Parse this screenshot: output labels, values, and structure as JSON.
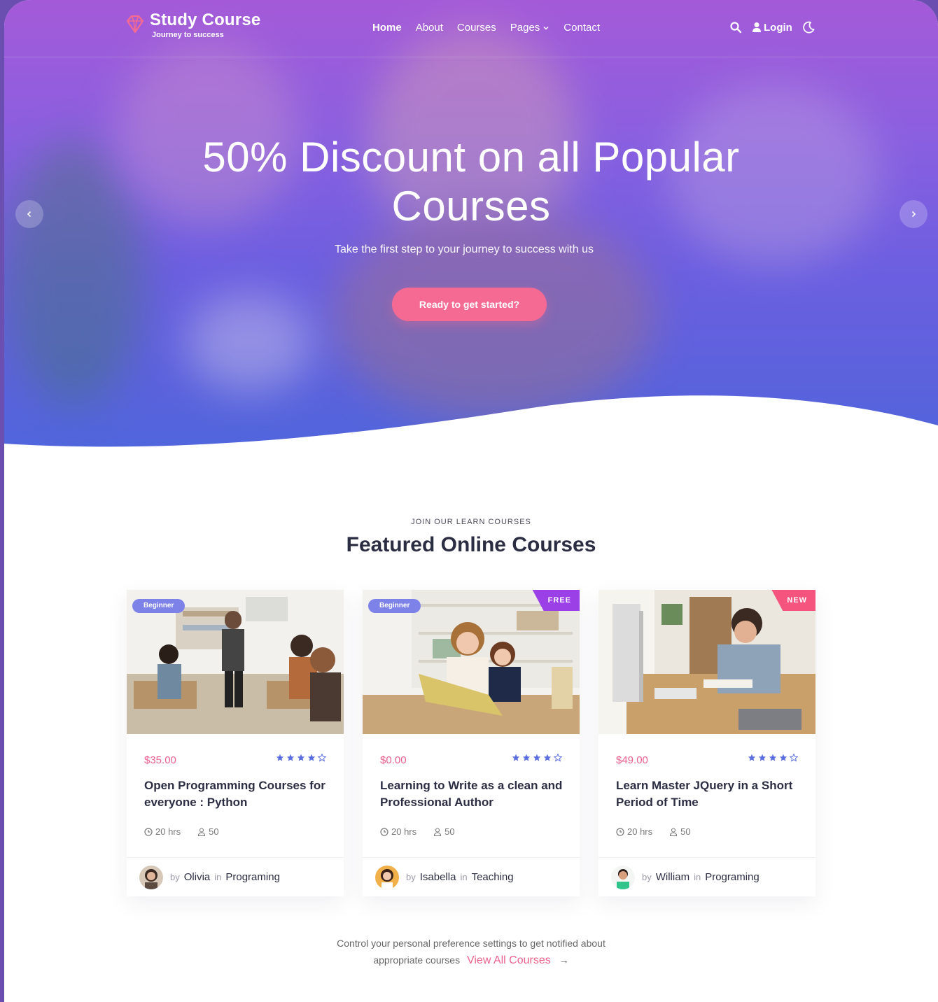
{
  "brand": {
    "title": "Study Course",
    "tagline": "Journey to success"
  },
  "nav": {
    "items": [
      {
        "label": "Home"
      },
      {
        "label": "About"
      },
      {
        "label": "Courses"
      },
      {
        "label": "Pages"
      },
      {
        "label": "Contact"
      }
    ],
    "login_label": "Login"
  },
  "hero": {
    "title_line1": "50% Discount on all Popular",
    "title_line2": "Courses",
    "subtitle": "Take the first step to your journey to success with us",
    "cta": "Ready to get started?"
  },
  "section": {
    "eyebrow": "JOIN OUR LEARN COURSES",
    "title": "Featured Online Courses"
  },
  "courses": [
    {
      "level": "Beginner",
      "ribbon": "",
      "price": "$35.00",
      "rating": 4,
      "title": "Open Programming Courses for everyone : Python",
      "hours": "20 hrs",
      "students": "50",
      "by": "by",
      "author": "Olivia",
      "in": "in",
      "category": "Programing"
    },
    {
      "level": "Beginner",
      "ribbon": "FREE",
      "price": "$0.00",
      "rating": 4,
      "title": "Learning to Write as a clean and Professional Author",
      "hours": "20 hrs",
      "students": "50",
      "by": "by",
      "author": "Isabella",
      "in": "in",
      "category": "Teaching"
    },
    {
      "level": "",
      "ribbon": "NEW",
      "price": "$49.00",
      "rating": 4,
      "title": "Learn Master JQuery in a Short Period of Time",
      "hours": "20 hrs",
      "students": "50",
      "by": "by",
      "author": "William",
      "in": "in",
      "category": "Programing"
    }
  ],
  "footer": {
    "line1": "Control your personal preference settings to get notified about",
    "line2": "appropriate courses",
    "link": "View All Courses",
    "arrow": "→"
  },
  "colors": {
    "accent": "#f56a93",
    "price": "#e9628d",
    "star": "#5a6ee0",
    "badge": "#7d82e8"
  }
}
